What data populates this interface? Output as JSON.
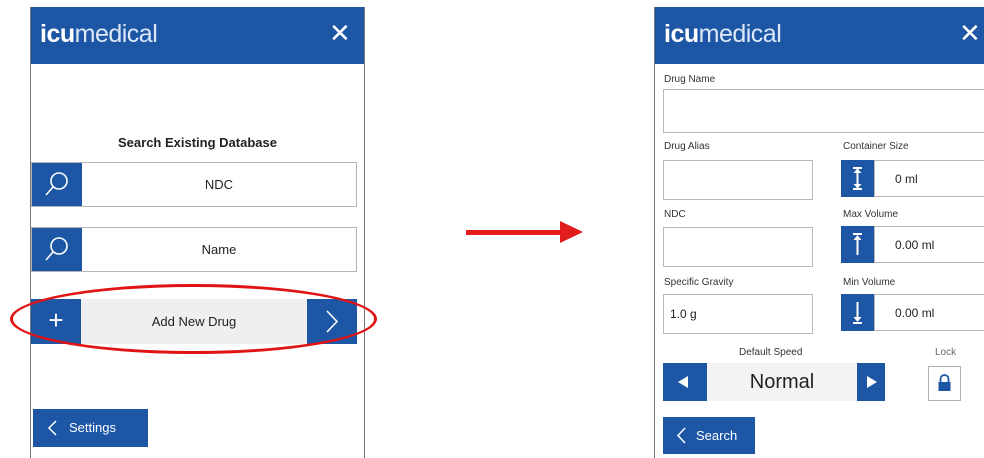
{
  "brand": {
    "bold": "icu",
    "light": "medical",
    "close_glyph": "✕"
  },
  "left": {
    "section_title": "Search Existing Database",
    "rows": [
      {
        "label": "NDC",
        "icon": "search-icon"
      },
      {
        "label": "Name",
        "icon": "search-icon"
      }
    ],
    "add": {
      "label": "Add New Drug",
      "icon": "plus-icon",
      "plus_glyph": "+",
      "arrow_icon": "chevron-right-icon"
    },
    "settings": {
      "label": "Settings",
      "icon": "chevron-left-icon"
    }
  },
  "right": {
    "drug_name": {
      "label": "Drug Name",
      "value": ""
    },
    "drug_alias": {
      "label": "Drug Alias",
      "value": ""
    },
    "ndc": {
      "label": "NDC",
      "value": ""
    },
    "specific_gravity": {
      "label": "Specific Gravity",
      "value": "1.0 g"
    },
    "container_size": {
      "label": "Container Size",
      "value": "0 ml",
      "icon": "double-arrow-vertical-icon"
    },
    "max_volume": {
      "label": "Max Volume",
      "value": "0.00 ml",
      "icon": "arrow-up-icon"
    },
    "min_volume": {
      "label": "Min Volume",
      "value": "0.00 ml",
      "icon": "arrow-down-icon"
    },
    "default_speed": {
      "label": "Default Speed",
      "value": "Normal"
    },
    "lock": {
      "label": "Lock",
      "icon": "lock-icon"
    },
    "search": {
      "label": "Search",
      "icon": "chevron-left-icon"
    }
  },
  "colors": {
    "brand_blue": "#1d56a5",
    "highlight_red": "#e01414"
  }
}
